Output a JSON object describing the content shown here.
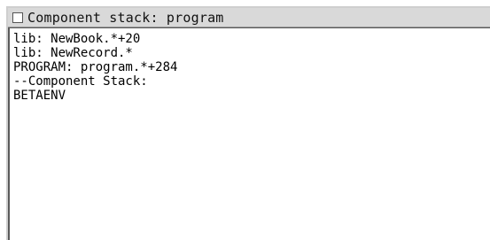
{
  "window": {
    "title": "Component stack: program"
  },
  "lines": [
    "lib: NewBook.*+20",
    "lib: NewRecord.*",
    "PROGRAM: program.*+284",
    "--Component Stack:",
    "BETAENV"
  ]
}
